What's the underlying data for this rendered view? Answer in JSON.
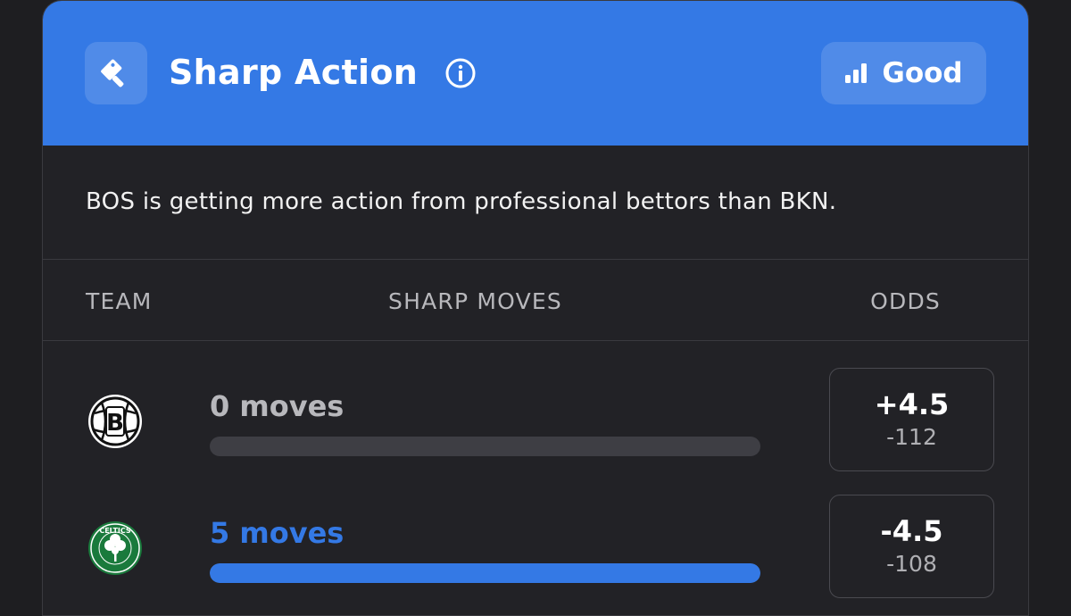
{
  "widget": {
    "title": "Sharp Action",
    "tool_icon": "cleaver-icon",
    "info_icon": "info-icon",
    "grade": {
      "icon": "signal-bars-icon",
      "label": "Good"
    },
    "accent_color": "#3479e5"
  },
  "description": "BOS is getting more action from professional bettors than BKN.",
  "columns": {
    "team": "TEAM",
    "moves": "SHARP MOVES",
    "odds": "ODDS"
  },
  "rows": [
    {
      "team_logo": "brooklyn-nets-logo",
      "moves_label": "0 moves",
      "moves_fraction": 0,
      "moves_color": "#b8b8bc",
      "odds_line": "+4.5",
      "odds_price": "-112"
    },
    {
      "team_logo": "boston-celtics-logo",
      "moves_label": "5 moves",
      "moves_fraction": 1,
      "moves_color": "#3479e5",
      "odds_line": "-4.5",
      "odds_price": "-108"
    }
  ]
}
